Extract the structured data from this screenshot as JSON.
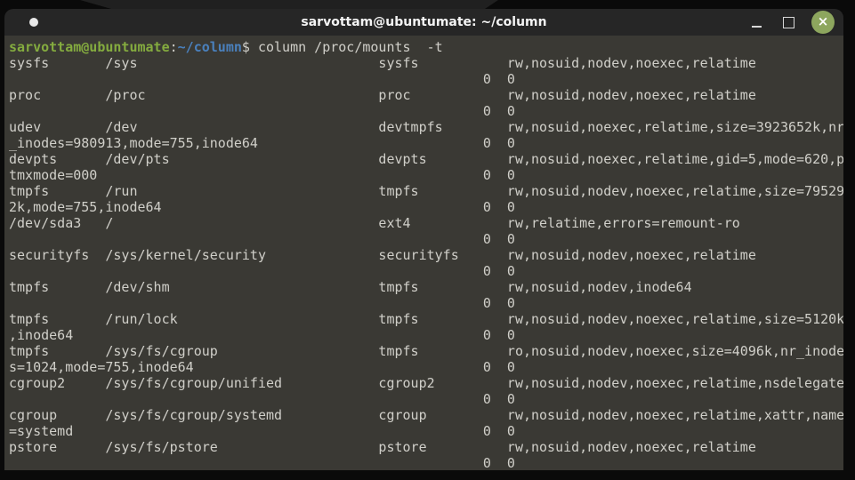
{
  "window": {
    "title": "sarvottam@ubuntumate: ~/column",
    "controls": {
      "minimize_label": "minimize",
      "maximize_label": "maximize",
      "close_label": "close",
      "close_glyph": "×"
    }
  },
  "palette": {
    "desktop_bg": "#0a0a0a",
    "wallpaper_wedge": "#202020",
    "titlebar_bg": "#262626",
    "titlebar_text": "#f4f4f4",
    "close_button_bg": "#8da65e",
    "terminal_bg": "#3a3934",
    "terminal_text": "#d0cfc9",
    "prompt_user_color": "#84ab3f",
    "prompt_path_color": "#4a80bc"
  },
  "terminal": {
    "prompt_user": "sarvottam@ubuntumate",
    "prompt_separator": ":",
    "prompt_path": "~/column",
    "prompt_command": "$ column /proc/mounts  -t",
    "layout": {
      "col_mountpoint": 12,
      "col_fstype": 46,
      "col_options": 62,
      "col_zeros": 59,
      "zeros_separator": "  "
    },
    "mounts": [
      {
        "device": "sysfs",
        "mountpoint": "/sys",
        "fstype": "sysfs",
        "options_line1": "rw,nosuid,nodev,noexec,relatime",
        "options_wrap": "",
        "dump": "0",
        "pass": "0"
      },
      {
        "device": "proc",
        "mountpoint": "/proc",
        "fstype": "proc",
        "options_line1": "rw,nosuid,nodev,noexec,relatime",
        "options_wrap": "",
        "dump": "0",
        "pass": "0"
      },
      {
        "device": "udev",
        "mountpoint": "/dev",
        "fstype": "devtmpfs",
        "options_line1": "rw,nosuid,noexec,relatime,size=3923652k,nr",
        "options_wrap": "_inodes=980913,mode=755,inode64",
        "dump": "0",
        "pass": "0"
      },
      {
        "device": "devpts",
        "mountpoint": "/dev/pts",
        "fstype": "devpts",
        "options_line1": "rw,nosuid,noexec,relatime,gid=5,mode=620,p",
        "options_wrap": "tmxmode=000",
        "dump": "0",
        "pass": "0"
      },
      {
        "device": "tmpfs",
        "mountpoint": "/run",
        "fstype": "tmpfs",
        "options_line1": "rw,nosuid,nodev,noexec,relatime,size=79529",
        "options_wrap": "2k,mode=755,inode64",
        "dump": "0",
        "pass": "0"
      },
      {
        "device": "/dev/sda3",
        "mountpoint": "/",
        "fstype": "ext4",
        "options_line1": "rw,relatime,errors=remount-ro",
        "options_wrap": "",
        "dump": "0",
        "pass": "0"
      },
      {
        "device": "securityfs",
        "mountpoint": "/sys/kernel/security",
        "fstype": "securityfs",
        "options_line1": "rw,nosuid,nodev,noexec,relatime",
        "options_wrap": "",
        "dump": "0",
        "pass": "0"
      },
      {
        "device": "tmpfs",
        "mountpoint": "/dev/shm",
        "fstype": "tmpfs",
        "options_line1": "rw,nosuid,nodev,inode64",
        "options_wrap": "",
        "dump": "0",
        "pass": "0"
      },
      {
        "device": "tmpfs",
        "mountpoint": "/run/lock",
        "fstype": "tmpfs",
        "options_line1": "rw,nosuid,nodev,noexec,relatime,size=5120k",
        "options_wrap": ",inode64",
        "dump": "0",
        "pass": "0"
      },
      {
        "device": "tmpfs",
        "mountpoint": "/sys/fs/cgroup",
        "fstype": "tmpfs",
        "options_line1": "ro,nosuid,nodev,noexec,size=4096k,nr_inode",
        "options_wrap": "s=1024,mode=755,inode64",
        "dump": "0",
        "pass": "0"
      },
      {
        "device": "cgroup2",
        "mountpoint": "/sys/fs/cgroup/unified",
        "fstype": "cgroup2",
        "options_line1": "rw,nosuid,nodev,noexec,relatime,nsdelegate",
        "options_wrap": "",
        "dump": "0",
        "pass": "0"
      },
      {
        "device": "cgroup",
        "mountpoint": "/sys/fs/cgroup/systemd",
        "fstype": "cgroup",
        "options_line1": "rw,nosuid,nodev,noexec,relatime,xattr,name",
        "options_wrap": "=systemd",
        "dump": "0",
        "pass": "0"
      },
      {
        "device": "pstore",
        "mountpoint": "/sys/fs/pstore",
        "fstype": "pstore",
        "options_line1": "rw,nosuid,nodev,noexec,relatime",
        "options_wrap": "",
        "dump": "0",
        "pass": "0"
      }
    ]
  }
}
